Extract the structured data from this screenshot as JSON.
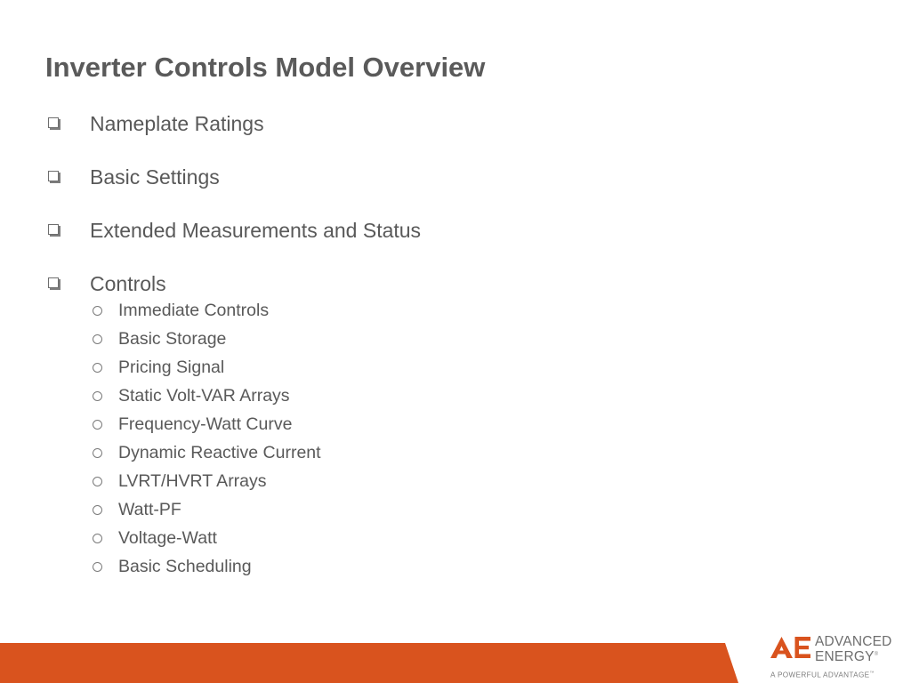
{
  "slide": {
    "title": "Inverter Controls Model Overview",
    "bullets": [
      {
        "label": "Nameplate Ratings",
        "bullet_icon": "hollow-square-bullet-icon",
        "children": []
      },
      {
        "label": "Basic Settings",
        "bullet_icon": "hollow-square-bullet-icon",
        "children": []
      },
      {
        "label": "Extended Measurements and Status",
        "bullet_icon": "hollow-square-bullet-icon",
        "children": []
      },
      {
        "label": "Controls",
        "bullet_icon": "hollow-square-bullet-icon",
        "children": [
          {
            "label": "Immediate Controls",
            "bullet_icon": "hollow-circle-bullet-icon"
          },
          {
            "label": "Basic Storage",
            "bullet_icon": "hollow-circle-bullet-icon"
          },
          {
            "label": "Pricing Signal",
            "bullet_icon": "hollow-circle-bullet-icon"
          },
          {
            "label": "Static Volt-VAR Arrays",
            "bullet_icon": "hollow-circle-bullet-icon"
          },
          {
            "label": "Frequency-Watt Curve",
            "bullet_icon": "hollow-circle-bullet-icon"
          },
          {
            "label": "Dynamic Reactive Current",
            "bullet_icon": "hollow-circle-bullet-icon"
          },
          {
            "label": "LVRT/HVRT Arrays",
            "bullet_icon": "hollow-circle-bullet-icon"
          },
          {
            "label": "Watt-PF",
            "bullet_icon": "hollow-circle-bullet-icon"
          },
          {
            "label": "Voltage-Watt",
            "bullet_icon": "hollow-circle-bullet-icon"
          },
          {
            "label": "Basic Scheduling",
            "bullet_icon": "hollow-circle-bullet-icon"
          }
        ]
      }
    ]
  },
  "footer": {
    "band_color": "#d9531e"
  },
  "logo": {
    "mark_icon": "advanced-energy-ae-mark-icon",
    "mark_color": "#d9531e",
    "word_line_1": "ADVANCED",
    "word_line_2": "ENERGY",
    "word_color": "#6e6e6e",
    "registered_mark": "®",
    "tagline": "A POWERFUL ADVANTAGE",
    "tagline_mark": "™"
  }
}
